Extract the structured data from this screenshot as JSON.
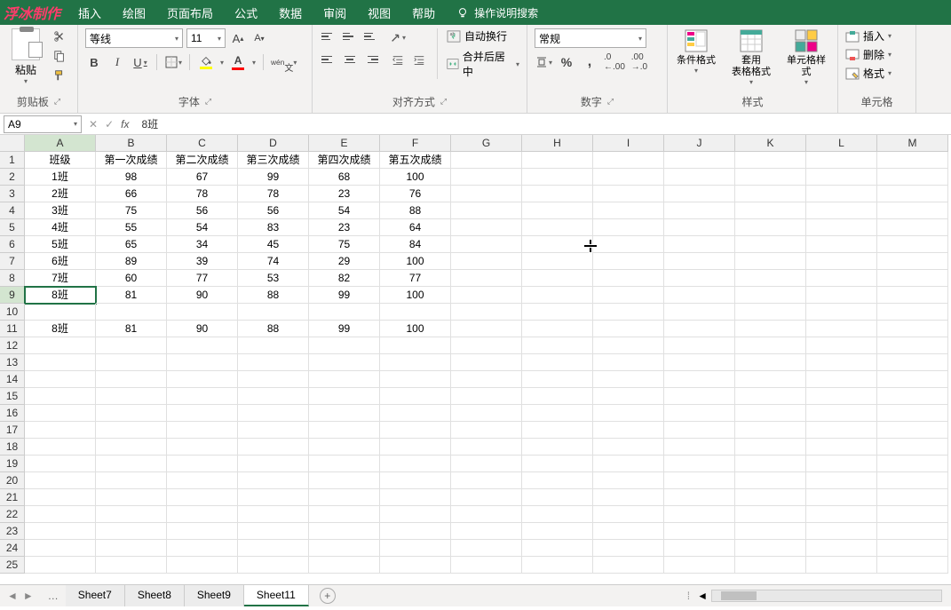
{
  "watermark": "浮冰制作",
  "menu": [
    "插入",
    "绘图",
    "页面布局",
    "公式",
    "数据",
    "审阅",
    "视图",
    "帮助"
  ],
  "tell_me": "操作说明搜索",
  "ribbon": {
    "clipboard": {
      "paste": "粘贴",
      "label": "剪贴板"
    },
    "font": {
      "name": "等线",
      "size": "11",
      "label": "字体"
    },
    "alignment": {
      "wrap": "自动换行",
      "merge": "合并后居中",
      "label": "对齐方式"
    },
    "number": {
      "fmt": "常规",
      "label": "数字"
    },
    "styles": {
      "cond": "条件格式",
      "table": "套用\n表格格式",
      "cell": "单元格样式",
      "label": "样式"
    },
    "cells": {
      "insert": "插入",
      "delete": "删除",
      "format": "格式",
      "label": "单元格"
    }
  },
  "namebox": "A9",
  "formula": "8班",
  "columns": [
    "A",
    "B",
    "C",
    "D",
    "E",
    "F",
    "G",
    "H",
    "I",
    "J",
    "K",
    "L",
    "M"
  ],
  "rows": 25,
  "active_cell": {
    "row": 9,
    "col": 0
  },
  "data": [
    [
      "班级",
      "第一次成绩",
      "第二次成绩",
      "第三次成绩",
      "第四次成绩",
      "第五次成绩"
    ],
    [
      "1班",
      "98",
      "67",
      "99",
      "68",
      "100"
    ],
    [
      "2班",
      "66",
      "78",
      "78",
      "23",
      "76"
    ],
    [
      "3班",
      "75",
      "56",
      "56",
      "54",
      "88"
    ],
    [
      "4班",
      "55",
      "54",
      "83",
      "23",
      "64"
    ],
    [
      "5班",
      "65",
      "34",
      "45",
      "75",
      "84"
    ],
    [
      "6班",
      "89",
      "39",
      "74",
      "29",
      "100"
    ],
    [
      "7班",
      "60",
      "77",
      "53",
      "82",
      "77"
    ],
    [
      "8班",
      "81",
      "90",
      "88",
      "99",
      "100"
    ],
    [],
    [
      "8班",
      "81",
      "90",
      "88",
      "99",
      "100"
    ]
  ],
  "sheets": [
    "Sheet7",
    "Sheet8",
    "Sheet9",
    "Sheet11"
  ],
  "active_sheet": "Sheet11"
}
